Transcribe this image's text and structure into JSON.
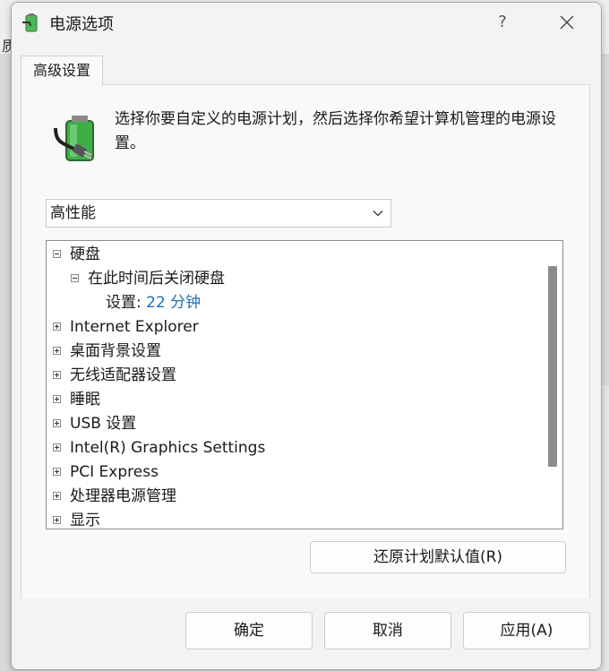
{
  "background": {
    "partial_char": "质"
  },
  "window": {
    "title": "电源选项",
    "help_label": "?",
    "icon": "power-options-icon"
  },
  "tabs": [
    {
      "label": "高级设置",
      "active": true
    }
  ],
  "description": "选择你要自定义的电源计划，然后选择你希望计算机管理的电源设置。",
  "plan_select": {
    "value": "高性能"
  },
  "tree": {
    "items": [
      {
        "label": "硬盘",
        "expander": "minus",
        "level": 0
      },
      {
        "label": "在此时间后关闭硬盘",
        "expander": "minus",
        "level": 1
      },
      {
        "label": "设置:",
        "value": "22 分钟",
        "level": 2
      },
      {
        "label": "Internet Explorer",
        "expander": "plus",
        "level": 0
      },
      {
        "label": "桌面背景设置",
        "expander": "plus",
        "level": 0
      },
      {
        "label": "无线适配器设置",
        "expander": "plus",
        "level": 0
      },
      {
        "label": "睡眠",
        "expander": "plus",
        "level": 0
      },
      {
        "label": "USB 设置",
        "expander": "plus",
        "level": 0
      },
      {
        "label": "Intel(R) Graphics Settings",
        "expander": "plus",
        "level": 0
      },
      {
        "label": "PCI Express",
        "expander": "plus",
        "level": 0
      },
      {
        "label": "处理器电源管理",
        "expander": "plus",
        "level": 0
      },
      {
        "label": "显示",
        "expander": "plus",
        "level": 0
      }
    ]
  },
  "buttons": {
    "restore": "还原计划默认值(R)",
    "ok": "确定",
    "cancel": "取消",
    "apply": "应用(A)"
  },
  "colors": {
    "value_text": "#1f6fb4",
    "battery_green": "#3fae49"
  }
}
